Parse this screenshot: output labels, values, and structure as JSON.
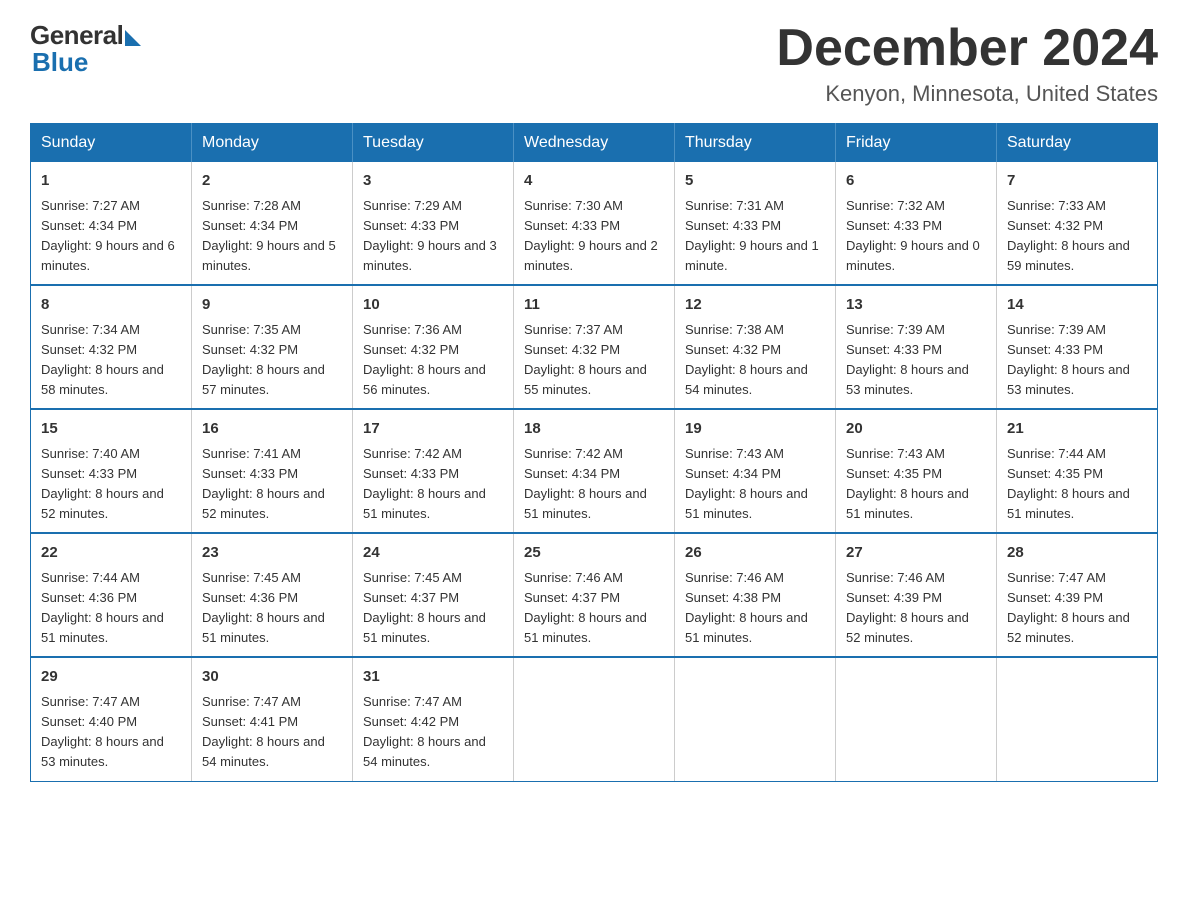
{
  "logo": {
    "general": "General",
    "blue": "Blue"
  },
  "header": {
    "month_year": "December 2024",
    "location": "Kenyon, Minnesota, United States"
  },
  "days_of_week": [
    "Sunday",
    "Monday",
    "Tuesday",
    "Wednesday",
    "Thursday",
    "Friday",
    "Saturday"
  ],
  "weeks": [
    [
      {
        "day": "1",
        "sunrise": "7:27 AM",
        "sunset": "4:34 PM",
        "daylight": "9 hours and 6 minutes."
      },
      {
        "day": "2",
        "sunrise": "7:28 AM",
        "sunset": "4:34 PM",
        "daylight": "9 hours and 5 minutes."
      },
      {
        "day": "3",
        "sunrise": "7:29 AM",
        "sunset": "4:33 PM",
        "daylight": "9 hours and 3 minutes."
      },
      {
        "day": "4",
        "sunrise": "7:30 AM",
        "sunset": "4:33 PM",
        "daylight": "9 hours and 2 minutes."
      },
      {
        "day": "5",
        "sunrise": "7:31 AM",
        "sunset": "4:33 PM",
        "daylight": "9 hours and 1 minute."
      },
      {
        "day": "6",
        "sunrise": "7:32 AM",
        "sunset": "4:33 PM",
        "daylight": "9 hours and 0 minutes."
      },
      {
        "day": "7",
        "sunrise": "7:33 AM",
        "sunset": "4:32 PM",
        "daylight": "8 hours and 59 minutes."
      }
    ],
    [
      {
        "day": "8",
        "sunrise": "7:34 AM",
        "sunset": "4:32 PM",
        "daylight": "8 hours and 58 minutes."
      },
      {
        "day": "9",
        "sunrise": "7:35 AM",
        "sunset": "4:32 PM",
        "daylight": "8 hours and 57 minutes."
      },
      {
        "day": "10",
        "sunrise": "7:36 AM",
        "sunset": "4:32 PM",
        "daylight": "8 hours and 56 minutes."
      },
      {
        "day": "11",
        "sunrise": "7:37 AM",
        "sunset": "4:32 PM",
        "daylight": "8 hours and 55 minutes."
      },
      {
        "day": "12",
        "sunrise": "7:38 AM",
        "sunset": "4:32 PM",
        "daylight": "8 hours and 54 minutes."
      },
      {
        "day": "13",
        "sunrise": "7:39 AM",
        "sunset": "4:33 PM",
        "daylight": "8 hours and 53 minutes."
      },
      {
        "day": "14",
        "sunrise": "7:39 AM",
        "sunset": "4:33 PM",
        "daylight": "8 hours and 53 minutes."
      }
    ],
    [
      {
        "day": "15",
        "sunrise": "7:40 AM",
        "sunset": "4:33 PM",
        "daylight": "8 hours and 52 minutes."
      },
      {
        "day": "16",
        "sunrise": "7:41 AM",
        "sunset": "4:33 PM",
        "daylight": "8 hours and 52 minutes."
      },
      {
        "day": "17",
        "sunrise": "7:42 AM",
        "sunset": "4:33 PM",
        "daylight": "8 hours and 51 minutes."
      },
      {
        "day": "18",
        "sunrise": "7:42 AM",
        "sunset": "4:34 PM",
        "daylight": "8 hours and 51 minutes."
      },
      {
        "day": "19",
        "sunrise": "7:43 AM",
        "sunset": "4:34 PM",
        "daylight": "8 hours and 51 minutes."
      },
      {
        "day": "20",
        "sunrise": "7:43 AM",
        "sunset": "4:35 PM",
        "daylight": "8 hours and 51 minutes."
      },
      {
        "day": "21",
        "sunrise": "7:44 AM",
        "sunset": "4:35 PM",
        "daylight": "8 hours and 51 minutes."
      }
    ],
    [
      {
        "day": "22",
        "sunrise": "7:44 AM",
        "sunset": "4:36 PM",
        "daylight": "8 hours and 51 minutes."
      },
      {
        "day": "23",
        "sunrise": "7:45 AM",
        "sunset": "4:36 PM",
        "daylight": "8 hours and 51 minutes."
      },
      {
        "day": "24",
        "sunrise": "7:45 AM",
        "sunset": "4:37 PM",
        "daylight": "8 hours and 51 minutes."
      },
      {
        "day": "25",
        "sunrise": "7:46 AM",
        "sunset": "4:37 PM",
        "daylight": "8 hours and 51 minutes."
      },
      {
        "day": "26",
        "sunrise": "7:46 AM",
        "sunset": "4:38 PM",
        "daylight": "8 hours and 51 minutes."
      },
      {
        "day": "27",
        "sunrise": "7:46 AM",
        "sunset": "4:39 PM",
        "daylight": "8 hours and 52 minutes."
      },
      {
        "day": "28",
        "sunrise": "7:47 AM",
        "sunset": "4:39 PM",
        "daylight": "8 hours and 52 minutes."
      }
    ],
    [
      {
        "day": "29",
        "sunrise": "7:47 AM",
        "sunset": "4:40 PM",
        "daylight": "8 hours and 53 minutes."
      },
      {
        "day": "30",
        "sunrise": "7:47 AM",
        "sunset": "4:41 PM",
        "daylight": "8 hours and 54 minutes."
      },
      {
        "day": "31",
        "sunrise": "7:47 AM",
        "sunset": "4:42 PM",
        "daylight": "8 hours and 54 minutes."
      },
      null,
      null,
      null,
      null
    ]
  ],
  "labels": {
    "sunrise": "Sunrise:",
    "sunset": "Sunset:",
    "daylight": "Daylight:"
  }
}
